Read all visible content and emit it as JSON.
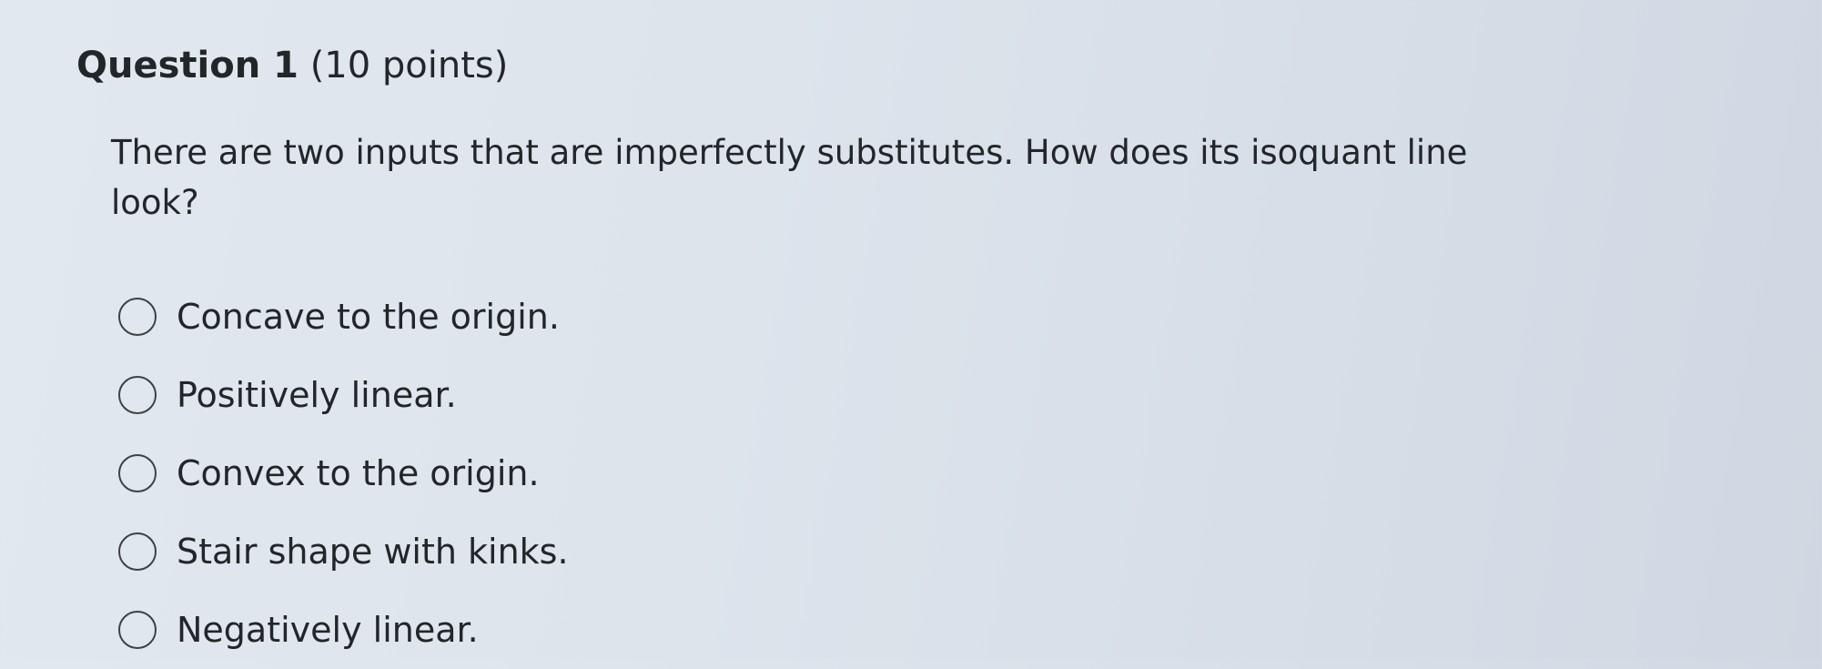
{
  "question": {
    "title": "Question 1",
    "points": "(10 points)",
    "text": "There are two inputs that are imperfectly substitutes. How does its isoquant line look?"
  },
  "options": [
    {
      "label": "Concave to the origin.",
      "selected": false
    },
    {
      "label": "Positively linear.",
      "selected": false
    },
    {
      "label": "Convex to the origin.",
      "selected": false
    },
    {
      "label": "Stair shape with kinks.",
      "selected": false
    },
    {
      "label": "Negatively linear.",
      "selected": false
    }
  ],
  "colors": {
    "text": "#232629",
    "radio_border": "#3d4146",
    "background": "#dde4ec"
  }
}
